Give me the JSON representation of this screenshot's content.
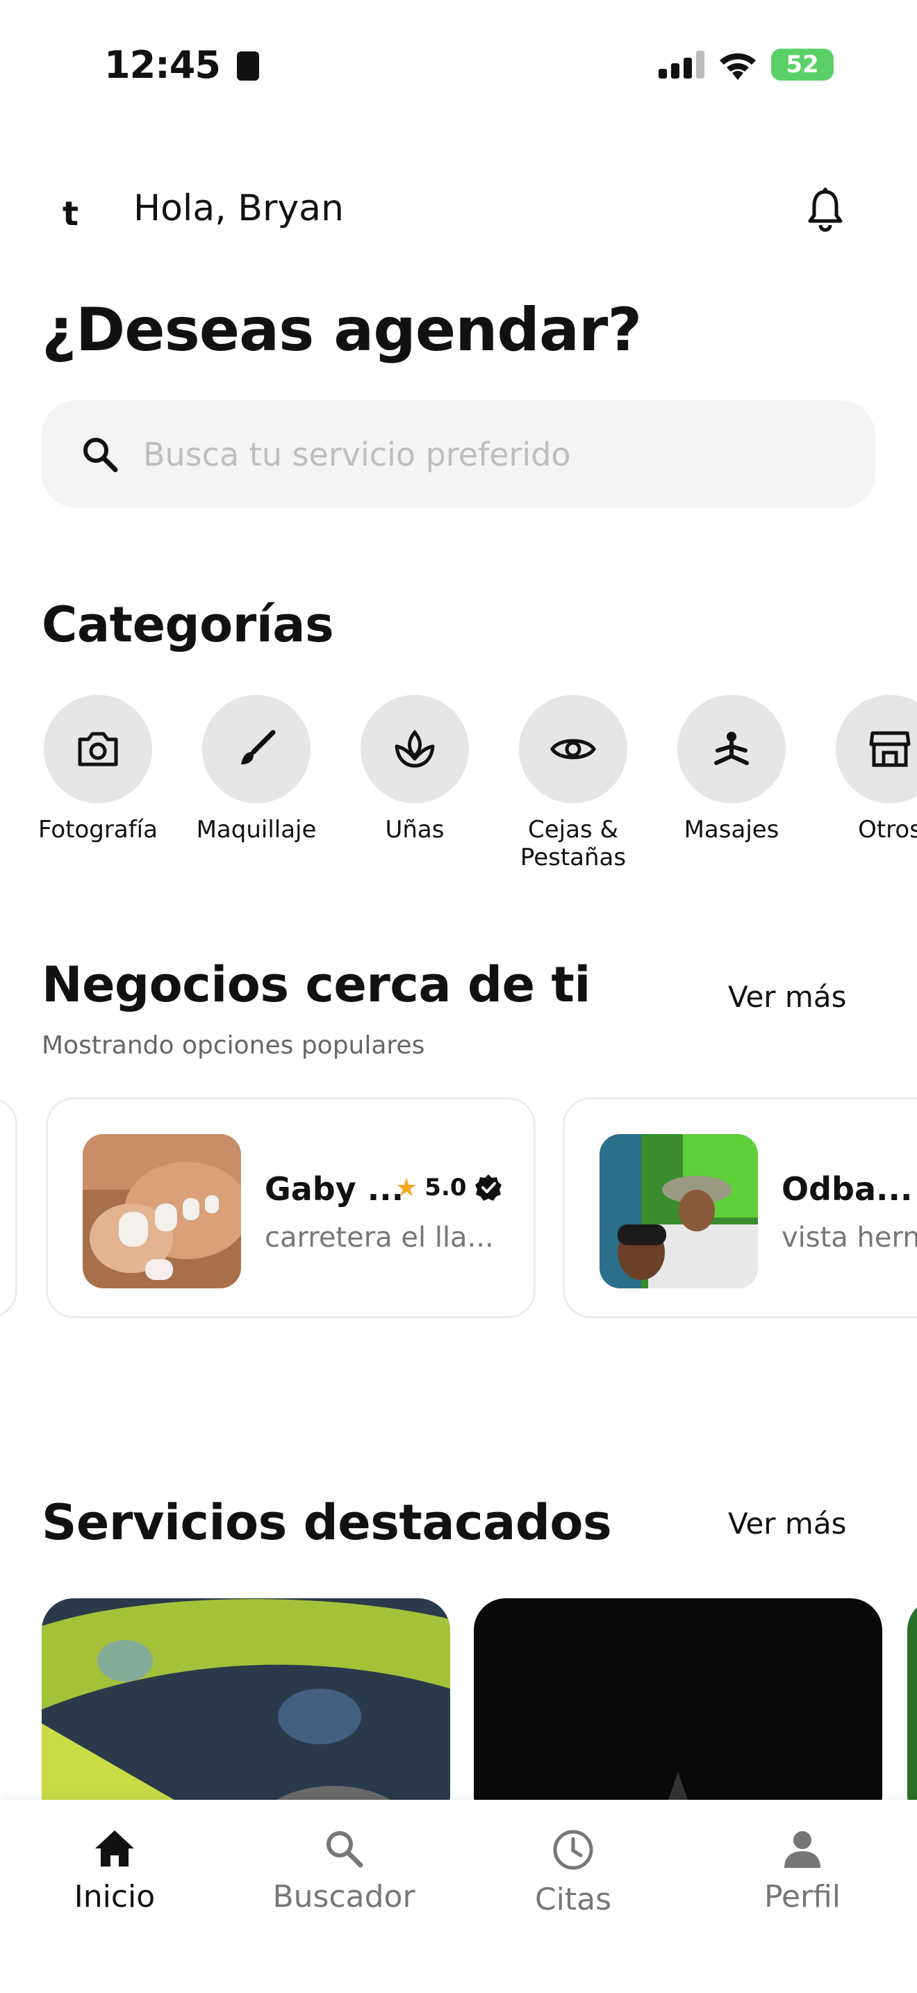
{
  "status_bar": {
    "time": "12:45",
    "battery": "52"
  },
  "header": {
    "logo": "t",
    "greeting": "Hola, Bryan"
  },
  "headline": "¿Deseas agendar?",
  "search": {
    "placeholder": "Busca tu servicio preferido"
  },
  "categories": {
    "title": "Categorías",
    "items": [
      {
        "label": "Fotografía",
        "icon": "camera-icon"
      },
      {
        "label": "Maquillaje",
        "icon": "brush-icon"
      },
      {
        "label": "Uñas",
        "icon": "nails-icon"
      },
      {
        "label": "Cejas & Pestañas",
        "icon": "eye-icon"
      },
      {
        "label": "Masajes",
        "icon": "massage-icon"
      },
      {
        "label": "Otros",
        "icon": "store-icon"
      }
    ]
  },
  "businesses": {
    "title": "Negocios cerca de ti",
    "ver_mas": "Ver más",
    "subtitle": "Mostrando opciones populares",
    "items": [
      {
        "name": "Gaby ...",
        "rating": "5.0",
        "address": "carretera el lla..."
      },
      {
        "name": "Odba...",
        "address": "vista hern"
      }
    ]
  },
  "featured": {
    "title": "Servicios destacados",
    "ver_mas": "Ver más"
  },
  "nav": [
    {
      "label": "Inicio",
      "icon": "home-icon",
      "active": true
    },
    {
      "label": "Buscador",
      "icon": "search-icon",
      "active": false
    },
    {
      "label": "Citas",
      "icon": "clock-icon",
      "active": false
    },
    {
      "label": "Perfil",
      "icon": "person-icon",
      "active": false
    }
  ],
  "colors": {
    "accent": "#111111",
    "star": "#f5a623",
    "battery": "#5bd068"
  }
}
